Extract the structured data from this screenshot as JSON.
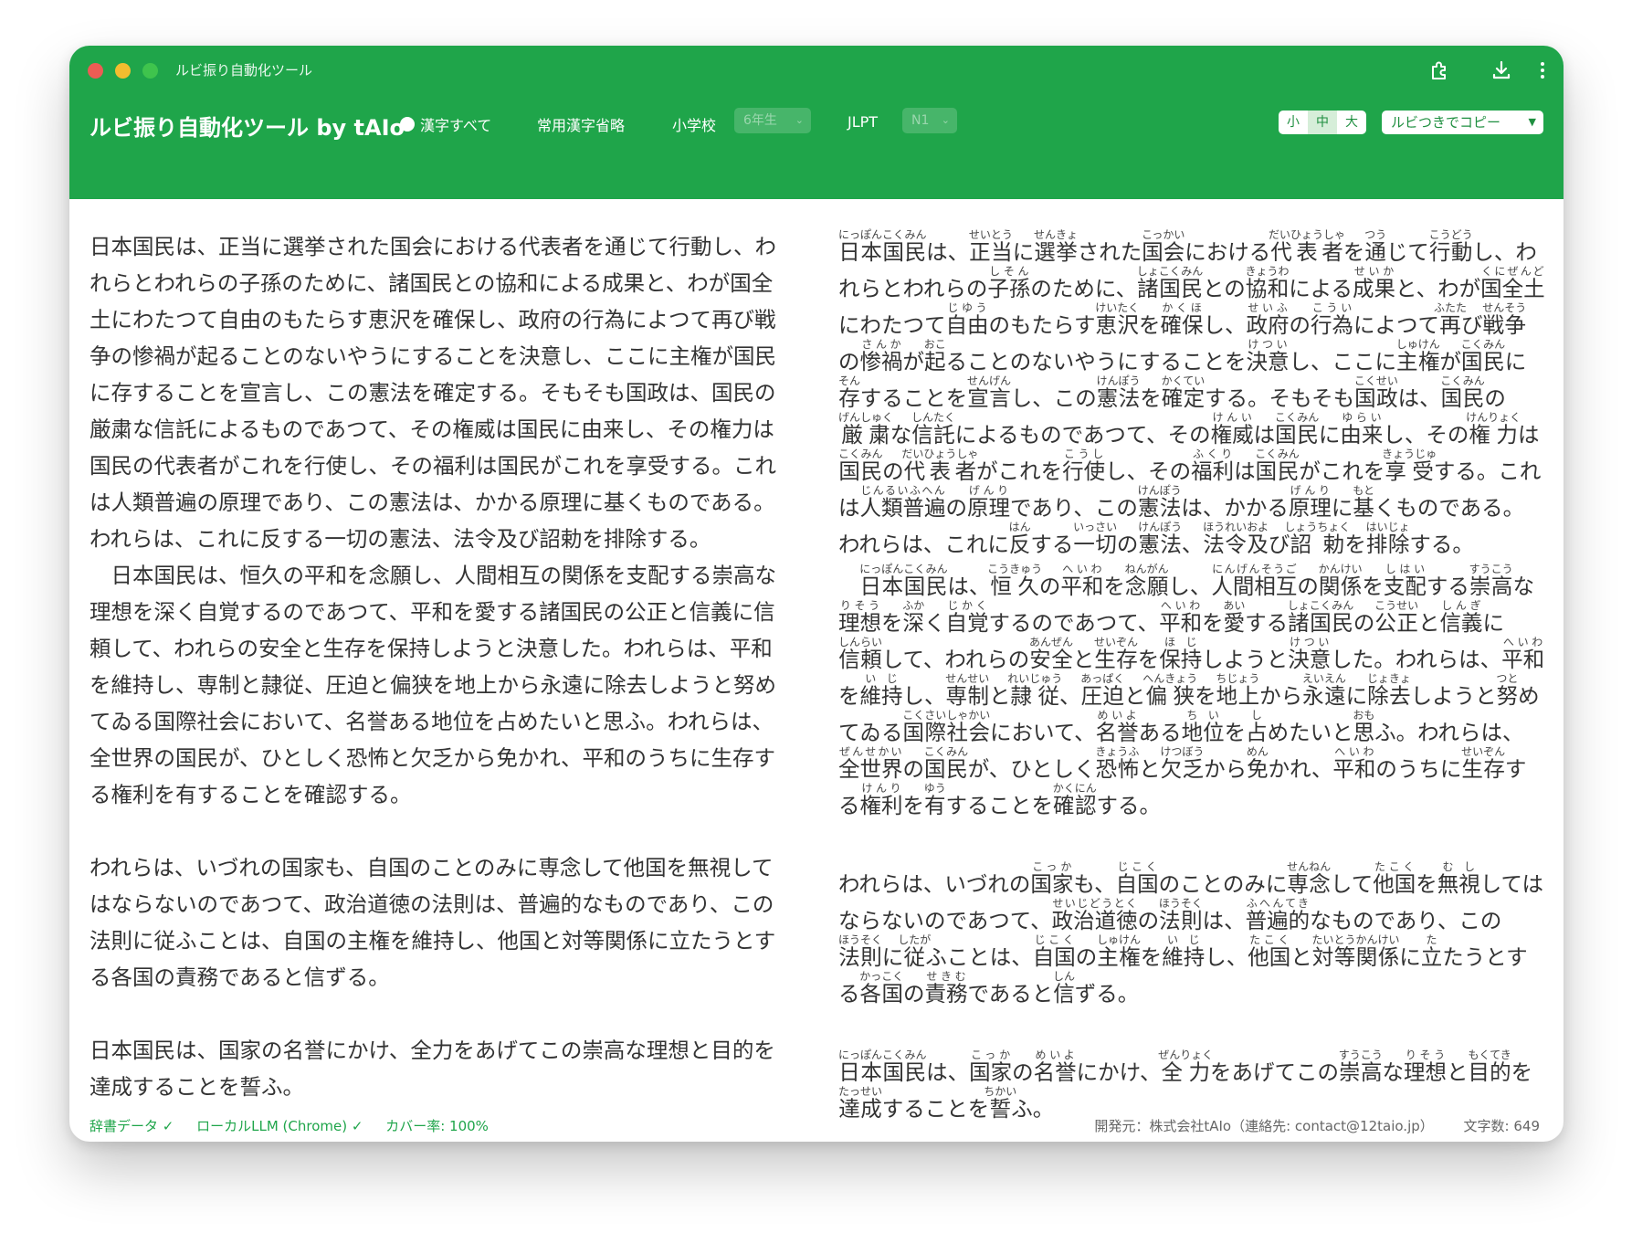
{
  "window": {
    "title": "ルビ振り自動化ツール"
  },
  "titlebar": {
    "icons": [
      "extension-icon",
      "download-icon",
      "more-icon"
    ]
  },
  "toolbar": {
    "app_title": "ルビ振り自動化ツール by tAIo",
    "radio_all_label": "漢字すべて",
    "joyo_label": "常用漢字省略",
    "school_label": "小学校",
    "school_grade_value": "6年生",
    "jlpt_label": "JLPT",
    "jlpt_value": "N1",
    "size_small": "小",
    "size_medium": "中",
    "size_large": "大",
    "copy_label": "ルビつきでコピー",
    "accent_color": "#1fa54a"
  },
  "original": {
    "paragraph1": "日本国民は、正当に選挙された国会における代表者を通じて行動し、われらとわれらの子孫のために、諸国民との協和による成果と、わが国全土にわたつて自由のもたらす恵沢を確保し、政府の行為によつて再び戦争の惨禍が起ることのないやうにすることを決意し、ここに主権が国民に存することを宣言し、この憲法を確定する。そもそも国政は、国民の厳粛な信託によるものであつて、その権威は国民に由来し、その権力は国民の代表者がこれを行使し、その福利は国民がこれを享受する。これは人類普遍の原理であり、この憲法は、かかる原理に基くものである。われらは、これに反する一切の憲法、法令及び詔勅を排除する。",
    "paragraph2": "　日本国民は、恒久の平和を念願し、人間相互の関係を支配する崇高な理想を深く自覚するのであつて、平和を愛する諸国民の公正と信義に信頼して、われらの安全と生存を保持しようと決意した。われらは、平和を維持し、専制と隷従、圧迫と偏狭を地上から永遠に除去しようと努めてゐる国際社会において、名誉ある地位を占めたいと思ふ。われらは、全世界の国民が、ひとしく恐怖と欠乏から免かれ、平和のうちに生存する権利を有することを確認する。",
    "paragraph3": "われらは、いづれの国家も、自国のことのみに専念して他国を無視してはならないのであつて、政治道徳の法則は、普遍的なものであり、この法則に従ふことは、自国の主権を維持し、他国と対等関係に立たうとする各国の責務であると信ずる。",
    "paragraph4": "日本国民は、国家の名誉にかけ、全力をあげてこの崇高な理想と目的を達成することを誓ふ。"
  },
  "ruby": {
    "paragraph1": [
      [
        "日本国民",
        "にっぽんこくみん"
      ],
      [
        "は、",
        ""
      ],
      [
        "正当",
        "せいとう"
      ],
      [
        "に",
        ""
      ],
      [
        "選挙",
        "せんきょ"
      ],
      [
        "された",
        ""
      ],
      [
        "国会",
        "こっかい"
      ],
      [
        "における",
        ""
      ],
      [
        "代表者",
        "だいひょうしゃ"
      ],
      [
        "を",
        ""
      ],
      [
        "通",
        "つう"
      ],
      [
        "じて",
        ""
      ],
      [
        "行動",
        "こうどう"
      ],
      [
        "し、われらとわれらの",
        ""
      ],
      [
        "子孫",
        "しそん"
      ],
      [
        "のために、",
        ""
      ],
      [
        "諸国民",
        "しょこくみん"
      ],
      [
        "との",
        ""
      ],
      [
        "協和",
        "きょうわ"
      ],
      [
        "による",
        ""
      ],
      [
        "成果",
        "せいか"
      ],
      [
        "と、わが",
        ""
      ],
      [
        "国全土",
        "くにぜんど"
      ],
      [
        "にわたつて",
        ""
      ],
      [
        "自由",
        "じゆう"
      ],
      [
        "のもたらす",
        ""
      ],
      [
        "恵沢",
        "けいたく"
      ],
      [
        "を",
        ""
      ],
      [
        "確保",
        "かくほ"
      ],
      [
        "し、",
        ""
      ],
      [
        "政府",
        "せいふ"
      ],
      [
        "の",
        ""
      ],
      [
        "行為",
        "こうい"
      ],
      [
        "によつて",
        ""
      ],
      [
        "再",
        "ふたた"
      ],
      [
        "び",
        ""
      ],
      [
        "戦争",
        "せんそう"
      ],
      [
        "の",
        ""
      ],
      [
        "惨禍",
        "さんか"
      ],
      [
        "が",
        ""
      ],
      [
        "起",
        "おこ"
      ],
      [
        "ることのないやうにすることを",
        ""
      ],
      [
        "決意",
        "けつい"
      ],
      [
        "し、ここに",
        ""
      ],
      [
        "主権",
        "しゅけん"
      ],
      [
        "が",
        ""
      ],
      [
        "国民",
        "こくみん"
      ],
      [
        "に",
        ""
      ],
      [
        "存",
        "そん"
      ],
      [
        "することを",
        ""
      ],
      [
        "宣言",
        "せんげん"
      ],
      [
        "し、この",
        ""
      ],
      [
        "憲法",
        "けんぽう"
      ],
      [
        "を",
        ""
      ],
      [
        "確定",
        "かくてい"
      ],
      [
        "する。そもそも",
        ""
      ],
      [
        "国政",
        "こくせい"
      ],
      [
        "は、",
        ""
      ],
      [
        "国民",
        "こくみん"
      ],
      [
        "の",
        ""
      ],
      [
        "厳粛",
        "げんしゅく"
      ],
      [
        "な",
        ""
      ],
      [
        "信託",
        "しんたく"
      ],
      [
        "によるものであつて、その",
        ""
      ],
      [
        "権威",
        "けんい"
      ],
      [
        "は",
        ""
      ],
      [
        "国民",
        "こくみん"
      ],
      [
        "に",
        ""
      ],
      [
        "由来",
        "ゆらい"
      ],
      [
        "し、その",
        ""
      ],
      [
        "権力",
        "けんりょく"
      ],
      [
        "は",
        ""
      ],
      [
        "国民",
        "こくみん"
      ],
      [
        "の",
        ""
      ],
      [
        "代表者",
        "だいひょうしゃ"
      ],
      [
        "がこれを",
        ""
      ],
      [
        "行使",
        "こうし"
      ],
      [
        "し、その",
        ""
      ],
      [
        "福利",
        "ふくり"
      ],
      [
        "は",
        ""
      ],
      [
        "国民",
        "こくみん"
      ],
      [
        "がこれを",
        ""
      ],
      [
        "享受",
        "きょうじゅ"
      ],
      [
        "する。これは",
        ""
      ],
      [
        "人類普遍",
        "じんるいふへん"
      ],
      [
        "の",
        ""
      ],
      [
        "原理",
        "げんり"
      ],
      [
        "であり、この",
        ""
      ],
      [
        "憲法",
        "けんぽう"
      ],
      [
        "は、かかる",
        ""
      ],
      [
        "原理",
        "げんり"
      ],
      [
        "に",
        ""
      ],
      [
        "基",
        "もと"
      ],
      [
        "くものである。われらは、これに",
        ""
      ],
      [
        "反",
        "はん"
      ],
      [
        "する",
        ""
      ],
      [
        "一切",
        "いっさい"
      ],
      [
        "の",
        ""
      ],
      [
        "憲法",
        "けんぽう"
      ],
      [
        "、",
        ""
      ],
      [
        "法令及",
        "ほうれいおよ"
      ],
      [
        "び",
        ""
      ],
      [
        "詔勅",
        "しょうちょく"
      ],
      [
        "を",
        ""
      ],
      [
        "排除",
        "はいじょ"
      ],
      [
        "する。",
        ""
      ]
    ],
    "paragraph2": [
      [
        "　",
        ""
      ],
      [
        "日本国民",
        "にっぽんこくみん"
      ],
      [
        "は、",
        ""
      ],
      [
        "恒久",
        "こうきゅう"
      ],
      [
        "の",
        ""
      ],
      [
        "平和",
        "へいわ"
      ],
      [
        "を",
        ""
      ],
      [
        "念願",
        "ねんがん"
      ],
      [
        "し、",
        ""
      ],
      [
        "人間相互",
        "にんげんそうご"
      ],
      [
        "の",
        ""
      ],
      [
        "関係",
        "かんけい"
      ],
      [
        "を",
        ""
      ],
      [
        "支配",
        "しはい"
      ],
      [
        "する",
        ""
      ],
      [
        "崇高",
        "すうこう"
      ],
      [
        "な",
        ""
      ],
      [
        "理想",
        "りそう"
      ],
      [
        "を",
        ""
      ],
      [
        "深",
        "ふか"
      ],
      [
        "く",
        ""
      ],
      [
        "自覚",
        "じかく"
      ],
      [
        "するのであつて、",
        ""
      ],
      [
        "平和",
        "へいわ"
      ],
      [
        "を",
        ""
      ],
      [
        "愛",
        "あい"
      ],
      [
        "する",
        ""
      ],
      [
        "諸国民",
        "しょこくみん"
      ],
      [
        "の",
        ""
      ],
      [
        "公正",
        "こうせい"
      ],
      [
        "と",
        ""
      ],
      [
        "信義",
        "しんぎ"
      ],
      [
        "に",
        ""
      ],
      [
        "信頼",
        "しんらい"
      ],
      [
        "して、われらの",
        ""
      ],
      [
        "安全",
        "あんぜん"
      ],
      [
        "と",
        ""
      ],
      [
        "生存",
        "せいぞん"
      ],
      [
        "を",
        ""
      ],
      [
        "保持",
        "ほじ"
      ],
      [
        "しようと",
        ""
      ],
      [
        "決意",
        "けつい"
      ],
      [
        "した。われらは、",
        ""
      ],
      [
        "平和",
        "へいわ"
      ],
      [
        "を",
        ""
      ],
      [
        "維持",
        "いじ"
      ],
      [
        "し、",
        ""
      ],
      [
        "専制",
        "せんせい"
      ],
      [
        "と",
        ""
      ],
      [
        "隷従",
        "れいじゅう"
      ],
      [
        "、",
        ""
      ],
      [
        "圧迫",
        "あっぱく"
      ],
      [
        "と",
        ""
      ],
      [
        "偏狭",
        "へんきょう"
      ],
      [
        "を",
        ""
      ],
      [
        "地上",
        "ちじょう"
      ],
      [
        "から",
        ""
      ],
      [
        "永遠",
        "えいえん"
      ],
      [
        "に",
        ""
      ],
      [
        "除去",
        "じょきょ"
      ],
      [
        "しようと",
        ""
      ],
      [
        "努",
        "つと"
      ],
      [
        "めてゐる",
        ""
      ],
      [
        "国際社会",
        "こくさいしゃかい"
      ],
      [
        "において、",
        ""
      ],
      [
        "名誉",
        "めいよ"
      ],
      [
        "ある",
        ""
      ],
      [
        "地位",
        "ちい"
      ],
      [
        "を",
        ""
      ],
      [
        "占",
        "し"
      ],
      [
        "めたいと",
        ""
      ],
      [
        "思",
        "おも"
      ],
      [
        "ふ。われらは、",
        ""
      ],
      [
        "全世界",
        "ぜんせかい"
      ],
      [
        "の",
        ""
      ],
      [
        "国民",
        "こくみん"
      ],
      [
        "が、ひとしく",
        ""
      ],
      [
        "恐怖",
        "きょうふ"
      ],
      [
        "と",
        ""
      ],
      [
        "欠乏",
        "けつぼう"
      ],
      [
        "から",
        ""
      ],
      [
        "免",
        "めん"
      ],
      [
        "かれ、",
        ""
      ],
      [
        "平和",
        "へいわ"
      ],
      [
        "のうちに",
        ""
      ],
      [
        "生存",
        "せいぞん"
      ],
      [
        "する",
        ""
      ],
      [
        "権利",
        "けんり"
      ],
      [
        "を",
        ""
      ],
      [
        "有",
        "ゆう"
      ],
      [
        "することを",
        ""
      ],
      [
        "確認",
        "かくにん"
      ],
      [
        "する。",
        ""
      ]
    ],
    "paragraph3": [
      [
        "われらは、いづれの",
        ""
      ],
      [
        "国家",
        "こっか"
      ],
      [
        "も、",
        ""
      ],
      [
        "自国",
        "じこく"
      ],
      [
        "のことのみに",
        ""
      ],
      [
        "専念",
        "せんねん"
      ],
      [
        "して",
        ""
      ],
      [
        "他国",
        "たこく"
      ],
      [
        "を",
        ""
      ],
      [
        "無視",
        "むし"
      ],
      [
        "してはならないのであつて、",
        ""
      ],
      [
        "政治道徳",
        "せいじどうとく"
      ],
      [
        "の",
        ""
      ],
      [
        "法則",
        "ほうそく"
      ],
      [
        "は、",
        ""
      ],
      [
        "普遍的",
        "ふへんてき"
      ],
      [
        "なものであり、この",
        ""
      ],
      [
        "法則",
        "ほうそく"
      ],
      [
        "に",
        ""
      ],
      [
        "従",
        "したが"
      ],
      [
        "ふことは、",
        ""
      ],
      [
        "自国",
        "じこく"
      ],
      [
        "の",
        ""
      ],
      [
        "主権",
        "しゅけん"
      ],
      [
        "を",
        ""
      ],
      [
        "維持",
        "いじ"
      ],
      [
        "し、",
        ""
      ],
      [
        "他国",
        "たこく"
      ],
      [
        "と",
        ""
      ],
      [
        "対等関係",
        "たいとうかんけい"
      ],
      [
        "に",
        ""
      ],
      [
        "立",
        "た"
      ],
      [
        "たうとする",
        ""
      ],
      [
        "各国",
        "かっこく"
      ],
      [
        "の",
        ""
      ],
      [
        "責務",
        "せきむ"
      ],
      [
        "であると",
        ""
      ],
      [
        "信",
        "しん"
      ],
      [
        "ずる。",
        ""
      ]
    ],
    "paragraph4": [
      [
        "日本国民",
        "にっぽんこくみん"
      ],
      [
        "は、",
        ""
      ],
      [
        "国家",
        "こっか"
      ],
      [
        "の",
        ""
      ],
      [
        "名誉",
        "めいよ"
      ],
      [
        "にかけ、",
        ""
      ],
      [
        "全力",
        "ぜんりょく"
      ],
      [
        "をあげてこの",
        ""
      ],
      [
        "崇高",
        "すうこう"
      ],
      [
        "な",
        ""
      ],
      [
        "理想",
        "りそう"
      ],
      [
        "と",
        ""
      ],
      [
        "目的",
        "もくてき"
      ],
      [
        "を",
        ""
      ],
      [
        "達成",
        "たっせい"
      ],
      [
        "することを",
        ""
      ],
      [
        "誓",
        "ちかい"
      ],
      [
        "ふ。",
        ""
      ]
    ]
  },
  "footer": {
    "dict_status": "辞書データ ✓",
    "llm_status": "ローカルLLM (Chrome) ✓",
    "coverage": "カバー率: 100%",
    "developer": "開発元：株式会社tAIo（連絡先: contact@12taio.jp）",
    "char_count": "文字数: 649"
  }
}
